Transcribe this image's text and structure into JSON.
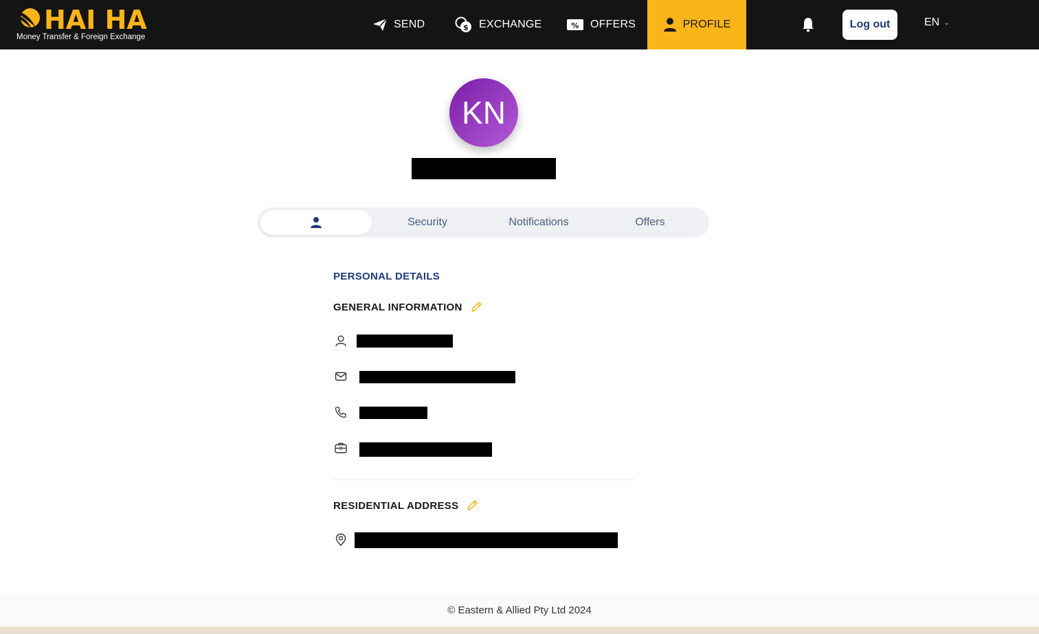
{
  "brand": {
    "name": "HAI HA",
    "tagline": "Money Transfer & Foreign Exchange",
    "accent_color": "#fbb419",
    "header_bg": "#141414"
  },
  "nav": {
    "send": "SEND",
    "exchange": "EXCHANGE",
    "offers": "OFFERS",
    "profile": "PROFILE",
    "logout": "Log out",
    "language": "EN"
  },
  "profile": {
    "initials": "KN",
    "avatar_colors": [
      "#7a1ea8",
      "#b45ad6"
    ]
  },
  "tabs": {
    "security": "Security",
    "notifications": "Notifications",
    "offers": "Offers",
    "active": "personal-details"
  },
  "details": {
    "section_title": "PERSONAL DETAILS",
    "general_title": "GENERAL INFORMATION",
    "residential_title": "RESIDENTIAL ADDRESS",
    "icons": [
      "user-icon",
      "mail-icon",
      "phone-icon",
      "briefcase-icon",
      "map-pin-icon",
      "edit-pencil-icon"
    ]
  },
  "footer": {
    "copyright": "© Eastern & Allied Pty Ltd 2024"
  }
}
